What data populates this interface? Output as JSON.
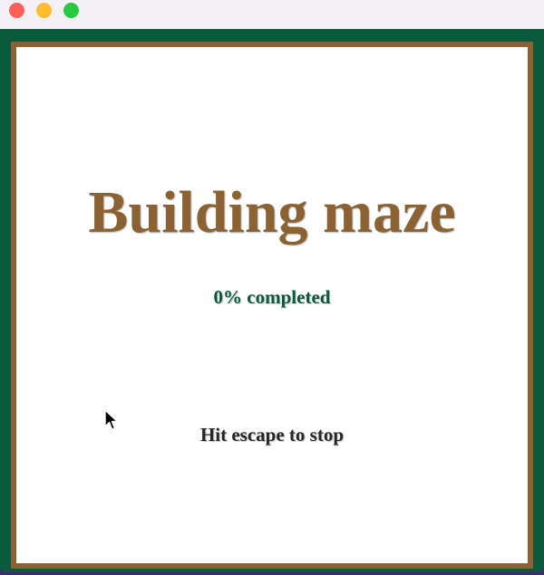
{
  "window": {
    "colors": {
      "background": "#0b5a3e",
      "titlebar": "#f3f1f6",
      "close": "#fe5f57",
      "minimize": "#febc2e",
      "zoom": "#28c840"
    }
  },
  "game": {
    "title": "Building maze",
    "progress_percent": "0%",
    "progress_suffix": " completed",
    "hint": "Hit escape to stop",
    "colors": {
      "title": "#8c6232",
      "progress": "#0b5a3e",
      "frame": "#8c6232",
      "hint": "#262626"
    }
  },
  "pointer": {
    "icon": "arrow-cursor-icon"
  }
}
